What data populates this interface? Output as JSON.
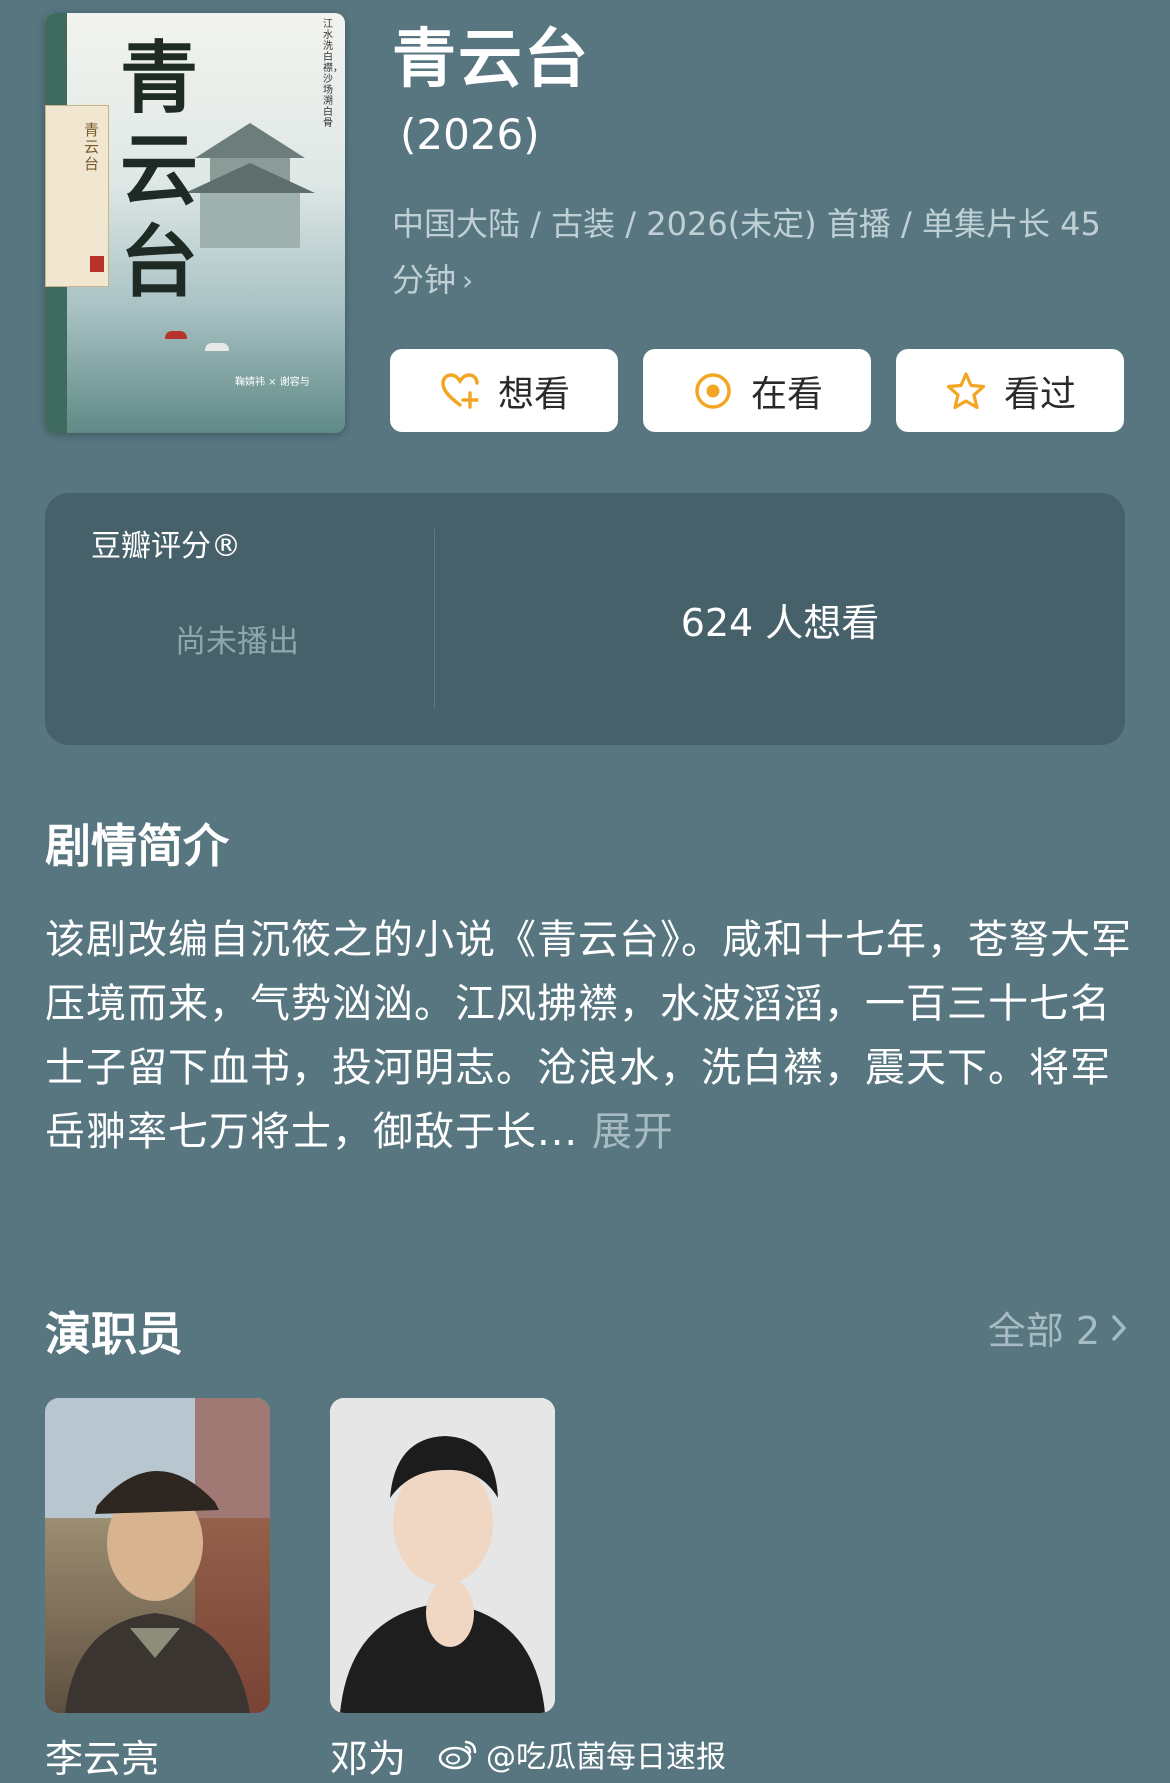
{
  "show": {
    "title": "青云台",
    "year": "(2026)",
    "meta": "中国大陆 / 古装 / 2026(未定) 首播 / 单集片长 45 分钟"
  },
  "poster": {
    "calligraphy": "青云台",
    "side_title": "青云台",
    "vertical_text": "江水洗白襟，沙场溯白骨",
    "credits": "鞠婧祎 × 谢容与"
  },
  "buttons": {
    "want": "想看",
    "watching": "在看",
    "watched": "看过"
  },
  "rating": {
    "label": "豆瓣评分®",
    "status": "尚未播出",
    "want_count": "624 人想看"
  },
  "synopsis": {
    "title": "剧情简介",
    "text": "该剧改编自沉筱之的小说《青云台》。咸和十七年，苍弩大军压境而来，气势汹汹。江风拂襟，水波滔滔，一百三十七名士子留下血书，投河明志。沧浪水，洗白襟，震天下。将军岳翀率七万将士，御敌于长...",
    "expand": "展开"
  },
  "cast": {
    "title": "演职员",
    "all_label": "全部 2",
    "members": [
      {
        "name": "李云亮"
      },
      {
        "name": "邓为"
      }
    ]
  },
  "watermark": "@吃瓜菌每日速报",
  "colors": {
    "background": "#577680",
    "panel": "#466169",
    "accent": "#f2a623"
  }
}
